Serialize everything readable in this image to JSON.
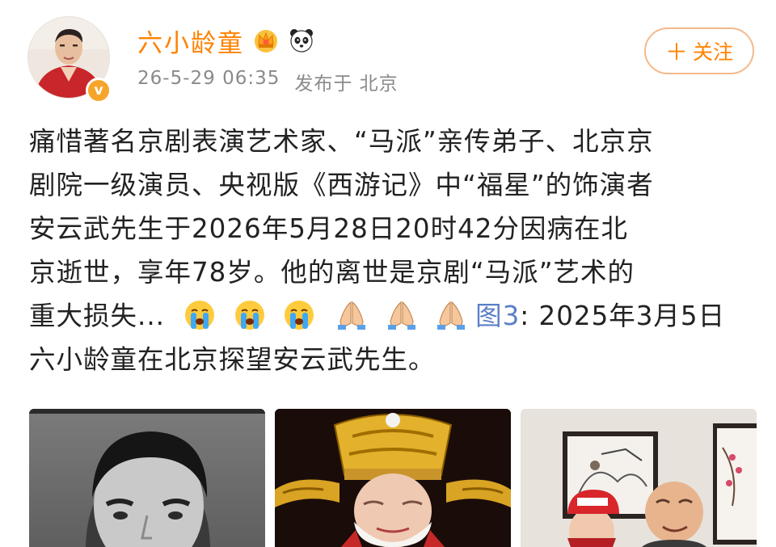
{
  "post": {
    "username": "六小龄童",
    "timestamp": "26-5-29 06:35",
    "location": "发布于 北京",
    "follow_label": "关注",
    "follow_plus": "＋",
    "verified_badge_icon": "verified-v-icon",
    "badges": [
      "vip-crown-icon",
      "panda-icon"
    ],
    "text_lines": [
      "痛惜著名京剧表演艺术家、“马派”亲传弟子、北京京",
      "剧院一级演员、央视版《西游记》中“福星”的饰演者",
      "安云武先生于2026年5月28日20时42分因病在北",
      "京逝世，享年78岁。他的离世是京剧“马派”艺术的"
    ],
    "line5_text": "重大损失...",
    "line5_emojis": [
      "crying-face-icon",
      "crying-face-icon",
      "crying-face-icon",
      "folded-hands-icon",
      "folded-hands-icon",
      "folded-hands-icon"
    ],
    "pic_link": "图3",
    "line5_tail": ": 2025年3月5日",
    "line6": "六小龄童在北京探望安云武先生。"
  },
  "images": [
    {
      "name": "portrait-photo"
    },
    {
      "name": "fuxing-costume-photo"
    },
    {
      "name": "visit-photo"
    }
  ],
  "colors": {
    "username": "#ff8200",
    "link": "#5b7fc7",
    "meta": "#8a8a8a",
    "text": "#222222"
  }
}
